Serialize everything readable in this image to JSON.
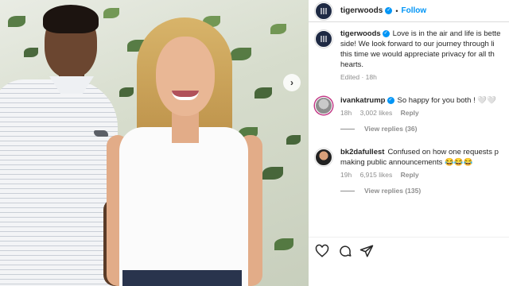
{
  "post": {
    "username": "tigerwoods",
    "follow_label": "Follow",
    "separator": "•",
    "caption": {
      "lines": [
        "Love is in the air and life is bette",
        "side! We look forward to our journey through li",
        "this time we would appreciate privacy for all th",
        "hearts."
      ],
      "edited": "Edited · 18h"
    }
  },
  "comments": [
    {
      "username": "ivankatrump",
      "text": "So happy for you both ! 🤍🤍",
      "time": "18h",
      "likes": "3,002 likes",
      "reply_label": "Reply",
      "view_replies": "View replies (36)"
    },
    {
      "username": "bk2dafullest",
      "text_line1": "Confused on how one requests p",
      "text_line2": "making public announcements 😂😂😂",
      "time": "19h",
      "likes": "6,915 likes",
      "reply_label": "Reply",
      "view_replies": "View replies (135)"
    }
  ],
  "icons": {
    "like": "heart-icon",
    "comment": "comment-icon",
    "share": "paper-plane-icon",
    "next": "chevron-right-icon",
    "verified": "verified-badge-icon"
  },
  "colors": {
    "accent": "#0095f6",
    "muted": "#8e8e8e",
    "text": "#262626"
  }
}
